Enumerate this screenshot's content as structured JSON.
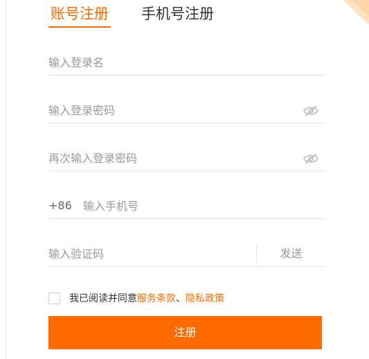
{
  "tabs": {
    "account": "账号注册",
    "phone": "手机号注册",
    "active": "account"
  },
  "form": {
    "username_placeholder": "输入登录名",
    "password_placeholder": "输入登录密码",
    "confirm_password_placeholder": "再次输入登录密码",
    "phone_prefix": "+86",
    "phone_placeholder": "输入手机号",
    "code_placeholder": "输入验证码",
    "send_label": "发送"
  },
  "agreement": {
    "checked": false,
    "text_before": "我已阅读并同意",
    "terms_link": "服务条款",
    "separator": "、",
    "privacy_link": "隐私政策"
  },
  "submit_label": "注册",
  "icons": {
    "password_visibility": "eye-slash-icon",
    "corner": "corner-decoration"
  },
  "colors": {
    "accent": "#ff6a00",
    "text": "#333333",
    "placeholder": "#999999",
    "divider": "#e6e6e6",
    "corner": "#fbd6a8"
  }
}
